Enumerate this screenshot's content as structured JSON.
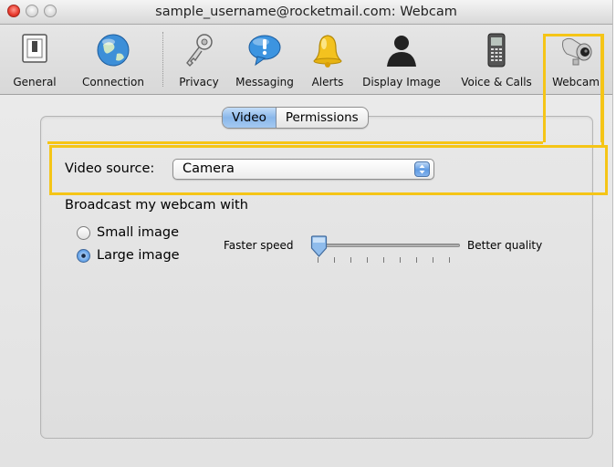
{
  "window": {
    "title": "sample_username@rocketmail.com: Webcam"
  },
  "toolbar": {
    "items": [
      {
        "label": "General",
        "icon": "switch-icon"
      },
      {
        "label": "Connection",
        "icon": "globe-icon"
      },
      {
        "label": "Privacy",
        "icon": "keys-icon"
      },
      {
        "label": "Messaging",
        "icon": "speech-bubble-icon"
      },
      {
        "label": "Alerts",
        "icon": "bell-icon"
      },
      {
        "label": "Display Image",
        "icon": "person-silhouette-icon"
      },
      {
        "label": "Voice & Calls",
        "icon": "phone-icon"
      },
      {
        "label": "Webcam",
        "icon": "webcam-icon"
      }
    ]
  },
  "tabs": {
    "items": [
      {
        "label": "Video",
        "selected": true
      },
      {
        "label": "Permissions",
        "selected": false
      }
    ]
  },
  "video": {
    "source_label": "Video source:",
    "source_value": "Camera",
    "broadcast_label": "Broadcast my webcam with",
    "small_image": "Small image",
    "large_image": "Large image",
    "selected_size": "Large image",
    "slider_left": "Faster speed",
    "slider_right": "Better quality",
    "slider_value": 0
  },
  "colors": {
    "highlight": "#f5c517",
    "selected_blue": "#8ab7ea"
  }
}
